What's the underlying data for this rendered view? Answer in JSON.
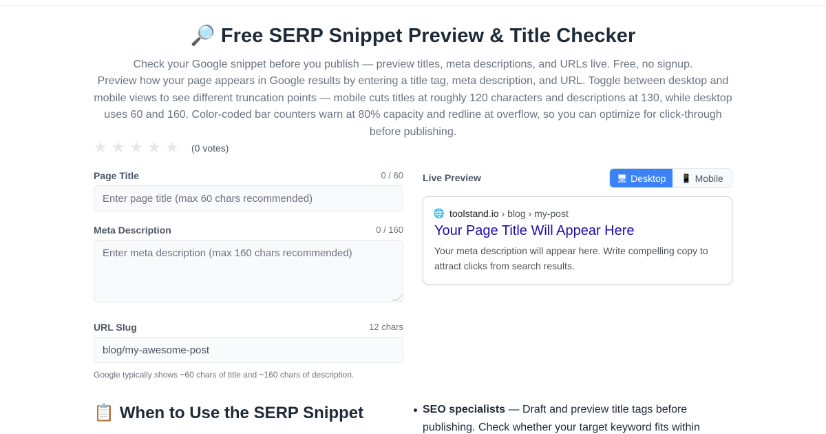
{
  "header": {
    "emoji": "🔎",
    "title": "Free SERP Snippet Preview & Title Checker",
    "tagline": "Check your Google snippet before you publish — preview titles, meta descriptions, and URLs live. Free, no signup.",
    "description": "Preview how your page appears in Google results by entering a title tag, meta description, and URL. Toggle between desktop and mobile views to see different truncation points — mobile cuts titles at roughly 120 characters and descriptions at 130, while desktop uses 60 and 160. Color-coded bar counters warn at 80% capacity and redline at overflow, so you can optimize for click-through before publishing."
  },
  "rating": {
    "stars": [
      "★",
      "★",
      "★",
      "★",
      "★"
    ],
    "filled": 0,
    "votes_label": "(0 votes)"
  },
  "form": {
    "title": {
      "label": "Page Title",
      "count": "0 / 60",
      "placeholder": "Enter page title (max 60 chars recommended)"
    },
    "meta": {
      "label": "Meta Description",
      "count": "0 / 160",
      "placeholder": "Enter meta description (max 160 chars recommended)"
    },
    "url": {
      "label": "URL Slug",
      "count": "12 chars",
      "value": "blog/my-awesome-post"
    },
    "hint": "Google typically shows ~60 chars of title and ~160 chars of description."
  },
  "preview": {
    "label": "Live Preview",
    "toggle": {
      "desktop": {
        "icon": "🖥",
        "label": "Desktop",
        "active": true
      },
      "mobile": {
        "icon": "📱",
        "label": "Mobile",
        "active": false
      }
    },
    "snippet": {
      "globe_icon": "🌐",
      "domain": "toolstand.io",
      "path": "› blog › my-post",
      "title": "Your Page Title Will Appear Here",
      "description": "Your meta description will appear here. Write compelling copy to attract clicks from search results."
    }
  },
  "section": {
    "emoji": "📋",
    "heading": "When to Use the SERP Snippet",
    "bullets": [
      {
        "strong": "SEO specialists",
        "text": " — Draft and preview title tags before publishing. Check whether your target keyword fits within"
      }
    ]
  },
  "colors": {
    "accent": "#3b82f6",
    "serp_title": "#1a0dab",
    "text_muted": "#6b7280",
    "input_bg": "#f9fafb"
  }
}
